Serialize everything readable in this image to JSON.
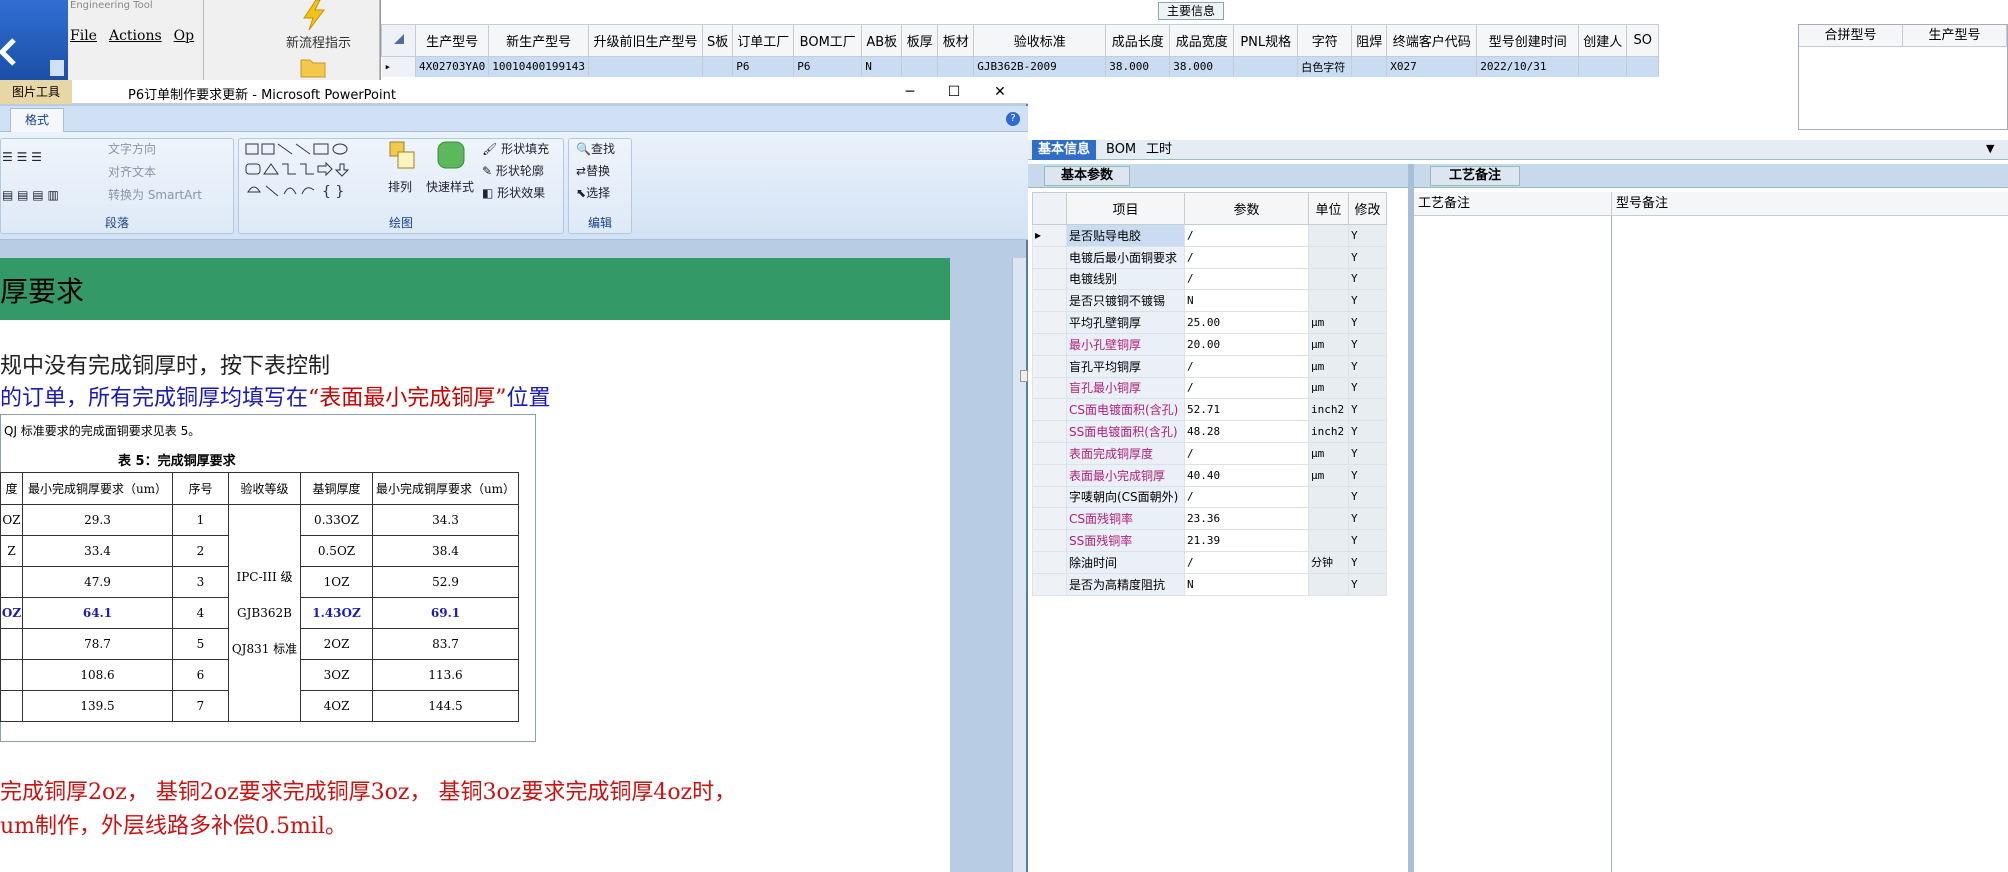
{
  "engineering": {
    "title": "Engineering Tool",
    "menu": [
      "File",
      "Actions",
      "Op"
    ],
    "flow_label": "新流程指示"
  },
  "main_grid": {
    "caption": "主要信息",
    "columns": [
      "生产型号",
      "新生产型号",
      "升级前旧生产型号",
      "S板",
      "订单工厂",
      "BOM工厂",
      "AB板",
      "板厚",
      "板材",
      "验收标准",
      "成品长度",
      "成品宽度",
      "PNL规格",
      "字符",
      "阻焊",
      "终端客户代码",
      "型号创建时间",
      "创建人",
      "SO"
    ],
    "row": [
      "4X02703YA0",
      "10010400199143",
      "",
      "",
      "P6",
      "P6",
      "N",
      "",
      "",
      "GJB362B-2009",
      "38.000",
      "38.000",
      "",
      "白色字符",
      "",
      "X027",
      "2022/10/31",
      "",
      ""
    ],
    "side_columns": [
      "合拼型号",
      "生产型号"
    ]
  },
  "ppt": {
    "tool_tab": "图片工具",
    "title": "P6订单制作要求更新 - Microsoft PowerPoint",
    "format_tab": "格式",
    "ribbon": {
      "para_group": "段落",
      "draw_group": "绘图",
      "edit_group": "编辑",
      "text_dir": "文字方向",
      "align_text": "对齐文本",
      "smartart": "转换为 SmartArt",
      "arrange": "排列",
      "quick_style": "快速样式",
      "shape_fill": "形状填充",
      "shape_outline": "形状轮廓",
      "shape_effect": "形状效果",
      "find": "查找",
      "replace": "替换",
      "select": "选择"
    },
    "slide": {
      "title": "厚要求",
      "line1": "规中没有完成铜厚时，按下表控制",
      "line2_a": "的订单，所有完成铜厚均填写在",
      "line2_q": "“表面最小完成铜厚”",
      "line2_b": "位置",
      "table_note": "QJ 标准要求的完成面铜要求见表 5。",
      "table_title": "表 5：完成铜厚要求",
      "table_headers": [
        "度",
        "最小完成铜厚要求（um）",
        "序号",
        "验收等级",
        "基铜厚度",
        "最小完成铜厚要求（um）"
      ],
      "table_rows": [
        [
          "OZ",
          "29.3",
          "1",
          "0.33OZ",
          "34.3"
        ],
        [
          "Z",
          "33.4",
          "2",
          "0.5OZ",
          "38.4"
        ],
        [
          "",
          "47.9",
          "3",
          "1OZ",
          "52.9"
        ],
        [
          "OZ",
          "64.1",
          "4",
          "1.43OZ",
          "69.1"
        ],
        [
          "",
          "78.7",
          "5",
          "2OZ",
          "83.7"
        ],
        [
          "",
          "108.6",
          "6",
          "3OZ",
          "113.6"
        ],
        [
          "",
          "139.5",
          "7",
          "4OZ",
          "144.5"
        ]
      ],
      "grade_lines": [
        "IPC-III 级",
        "GJB362B",
        "QJ831 标准"
      ],
      "red1": "完成铜厚2oz，  基铜2oz要求完成铜厚3oz，  基铜3oz要求完成铜厚4oz时，",
      "red2": "um制作，外层线路多补偿0.5mil。"
    }
  },
  "app": {
    "tabs": [
      "基本信息",
      "BOM",
      "工时"
    ],
    "sub_tab_basic": "基本参数",
    "sub_tab_craft": "工艺备注",
    "param_headers": [
      "项目",
      "参数",
      "单位",
      "修改"
    ],
    "params": [
      {
        "item": "是否贴导电胶",
        "val": "/",
        "unit": "",
        "mod": "Y",
        "pink": false
      },
      {
        "item": "电镀后最小面铜要求",
        "val": "/",
        "unit": "",
        "mod": "Y",
        "pink": false
      },
      {
        "item": "电镀线别",
        "val": "/",
        "unit": "",
        "mod": "Y",
        "pink": false
      },
      {
        "item": "是否只镀铜不镀锡",
        "val": "N",
        "unit": "",
        "mod": "Y",
        "pink": false
      },
      {
        "item": "平均孔壁铜厚",
        "val": "25.00",
        "unit": "μm",
        "mod": "Y",
        "pink": false
      },
      {
        "item": "最小孔壁铜厚",
        "val": "20.00",
        "unit": "μm",
        "mod": "Y",
        "pink": true
      },
      {
        "item": "盲孔平均铜厚",
        "val": "/",
        "unit": "μm",
        "mod": "Y",
        "pink": false
      },
      {
        "item": "盲孔最小铜厚",
        "val": "/",
        "unit": "μm",
        "mod": "Y",
        "pink": true
      },
      {
        "item": "CS面电镀面积(含孔)",
        "val": "52.71",
        "unit": "inch2",
        "mod": "Y",
        "pink": true
      },
      {
        "item": "SS面电镀面积(含孔)",
        "val": "48.28",
        "unit": "inch2",
        "mod": "Y",
        "pink": true
      },
      {
        "item": "表面完成铜厚度",
        "val": "/",
        "unit": "μm",
        "mod": "Y",
        "pink": true
      },
      {
        "item": "表面最小完成铜厚",
        "val": "40.40",
        "unit": "μm",
        "mod": "Y",
        "pink": true
      },
      {
        "item": "字唛朝向(CS面朝外)",
        "val": "/",
        "unit": "",
        "mod": "Y",
        "pink": false
      },
      {
        "item": "CS面残铜率",
        "val": "23.36",
        "unit": "",
        "mod": "Y",
        "pink": true
      },
      {
        "item": "SS面残铜率",
        "val": "21.39",
        "unit": "",
        "mod": "Y",
        "pink": true
      },
      {
        "item": "除油时间",
        "val": "/",
        "unit": "分钟",
        "mod": "Y",
        "pink": false
      },
      {
        "item": "是否为高精度阻抗",
        "val": "N",
        "unit": "",
        "mod": "Y",
        "pink": false
      }
    ],
    "craft_headers": [
      "工艺备注",
      "型号备注"
    ]
  }
}
